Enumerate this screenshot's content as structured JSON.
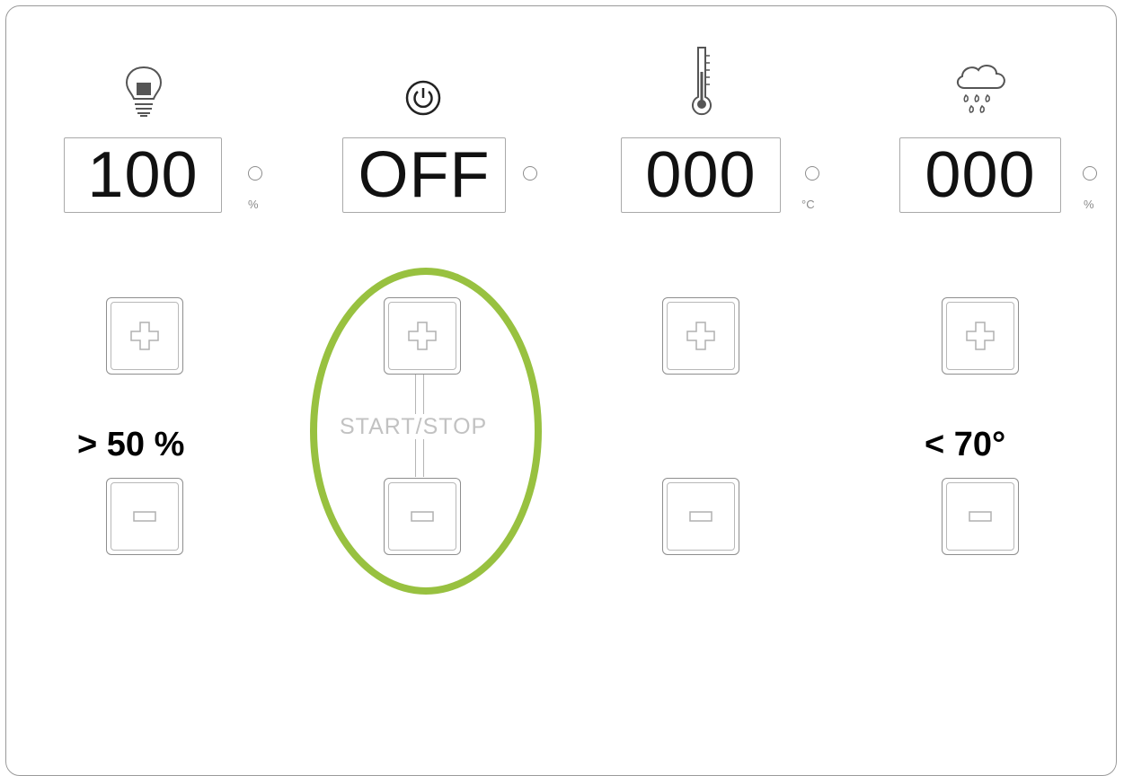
{
  "panel": {
    "columns": [
      {
        "id": "light",
        "icon": "light-bulb-icon",
        "display_value": "100",
        "unit": "%",
        "threshold": "> 50 %"
      },
      {
        "id": "power",
        "icon": "power-icon",
        "display_value": "OFF",
        "unit": "",
        "start_stop_label": "START/STOP"
      },
      {
        "id": "temperature",
        "icon": "thermometer-icon",
        "display_value": "000",
        "unit": "°C"
      },
      {
        "id": "rain",
        "icon": "rain-cloud-icon",
        "display_value": "000",
        "unit": "%",
        "threshold": "< 70°"
      }
    ]
  },
  "colors": {
    "highlight_ring": "#98c140",
    "border": "#9a9a9a",
    "label_gray": "#c2c2c2"
  }
}
